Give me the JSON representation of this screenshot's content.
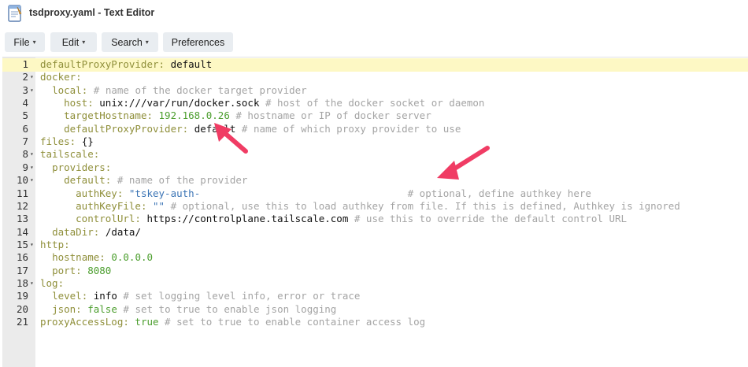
{
  "window": {
    "title": "tsdproxy.yaml - Text Editor"
  },
  "toolbar": {
    "file": "File",
    "edit": "Edit",
    "search": "Search",
    "preferences": "Preferences",
    "caret": "▾"
  },
  "colors": {
    "annotation_arrow": "#f03c64",
    "active_line": "#fdf8c4",
    "gutter": "#ebebeb"
  },
  "editor": {
    "lines": [
      {
        "n": "1",
        "fold": false,
        "indent": "",
        "key": "defaultProxyProvider",
        "colon": ": ",
        "value": "default",
        "vtype": "v",
        "comment": ""
      },
      {
        "n": "2",
        "fold": true,
        "indent": "",
        "key": "docker",
        "colon": ":",
        "value": "",
        "vtype": "v",
        "comment": ""
      },
      {
        "n": "3",
        "fold": true,
        "indent": "  ",
        "key": "local",
        "colon": ": ",
        "value": "",
        "vtype": "v",
        "comment": "# name of the docker target provider"
      },
      {
        "n": "4",
        "fold": false,
        "indent": "    ",
        "key": "host",
        "colon": ": ",
        "value": "unix:///var/run/docker.sock",
        "vtype": "v",
        "comment": " # host of the docker socket or daemon"
      },
      {
        "n": "5",
        "fold": false,
        "indent": "    ",
        "key": "targetHostname",
        "colon": ": ",
        "value": "192.168.0.26",
        "vtype": "n",
        "comment": " # hostname or IP of docker server"
      },
      {
        "n": "6",
        "fold": false,
        "indent": "    ",
        "key": "defaultProxyProvider",
        "colon": ": ",
        "value": "default",
        "vtype": "v",
        "comment": " # name of which proxy provider to use"
      },
      {
        "n": "7",
        "fold": false,
        "indent": "",
        "key": "files",
        "colon": ": ",
        "value": "{}",
        "vtype": "v",
        "comment": ""
      },
      {
        "n": "8",
        "fold": true,
        "indent": "",
        "key": "tailscale",
        "colon": ":",
        "value": "",
        "vtype": "v",
        "comment": ""
      },
      {
        "n": "9",
        "fold": true,
        "indent": "  ",
        "key": "providers",
        "colon": ":",
        "value": "",
        "vtype": "v",
        "comment": ""
      },
      {
        "n": "10",
        "fold": true,
        "indent": "    ",
        "key": "default",
        "colon": ": ",
        "value": "",
        "vtype": "v",
        "comment": "# name of the provider"
      },
      {
        "n": "11",
        "fold": false,
        "indent": "      ",
        "key": "authKey",
        "colon": ": ",
        "value": "\"tskey-auth-",
        "vtype": "s",
        "comment": "                                   # optional, define authkey here"
      },
      {
        "n": "12",
        "fold": false,
        "indent": "      ",
        "key": "authKeyFile",
        "colon": ": ",
        "value": "\"\"",
        "vtype": "s",
        "comment": " # optional, use this to load authkey from file. If this is defined, Authkey is ignored"
      },
      {
        "n": "13",
        "fold": false,
        "indent": "      ",
        "key": "controlUrl",
        "colon": ": ",
        "value": "https://controlplane.tailscale.com",
        "vtype": "v",
        "comment": " # use this to override the default control URL"
      },
      {
        "n": "14",
        "fold": false,
        "indent": "  ",
        "key": "dataDir",
        "colon": ": ",
        "value": "/data/",
        "vtype": "v",
        "comment": ""
      },
      {
        "n": "15",
        "fold": true,
        "indent": "",
        "key": "http",
        "colon": ":",
        "value": "",
        "vtype": "v",
        "comment": ""
      },
      {
        "n": "16",
        "fold": false,
        "indent": "  ",
        "key": "hostname",
        "colon": ": ",
        "value": "0.0.0.0",
        "vtype": "n",
        "comment": ""
      },
      {
        "n": "17",
        "fold": false,
        "indent": "  ",
        "key": "port",
        "colon": ": ",
        "value": "8080",
        "vtype": "n",
        "comment": ""
      },
      {
        "n": "18",
        "fold": true,
        "indent": "",
        "key": "log",
        "colon": ":",
        "value": "",
        "vtype": "v",
        "comment": ""
      },
      {
        "n": "19",
        "fold": false,
        "indent": "  ",
        "key": "level",
        "colon": ": ",
        "value": "info",
        "vtype": "v",
        "comment": " # set logging level info, error or trace"
      },
      {
        "n": "20",
        "fold": false,
        "indent": "  ",
        "key": "json",
        "colon": ": ",
        "value": "false",
        "vtype": "b",
        "comment": " # set to true to enable json logging"
      },
      {
        "n": "21",
        "fold": false,
        "indent": "",
        "key": "proxyAccessLog",
        "colon": ": ",
        "value": "true",
        "vtype": "b",
        "comment": " # set to true to enable container access log"
      }
    ]
  }
}
